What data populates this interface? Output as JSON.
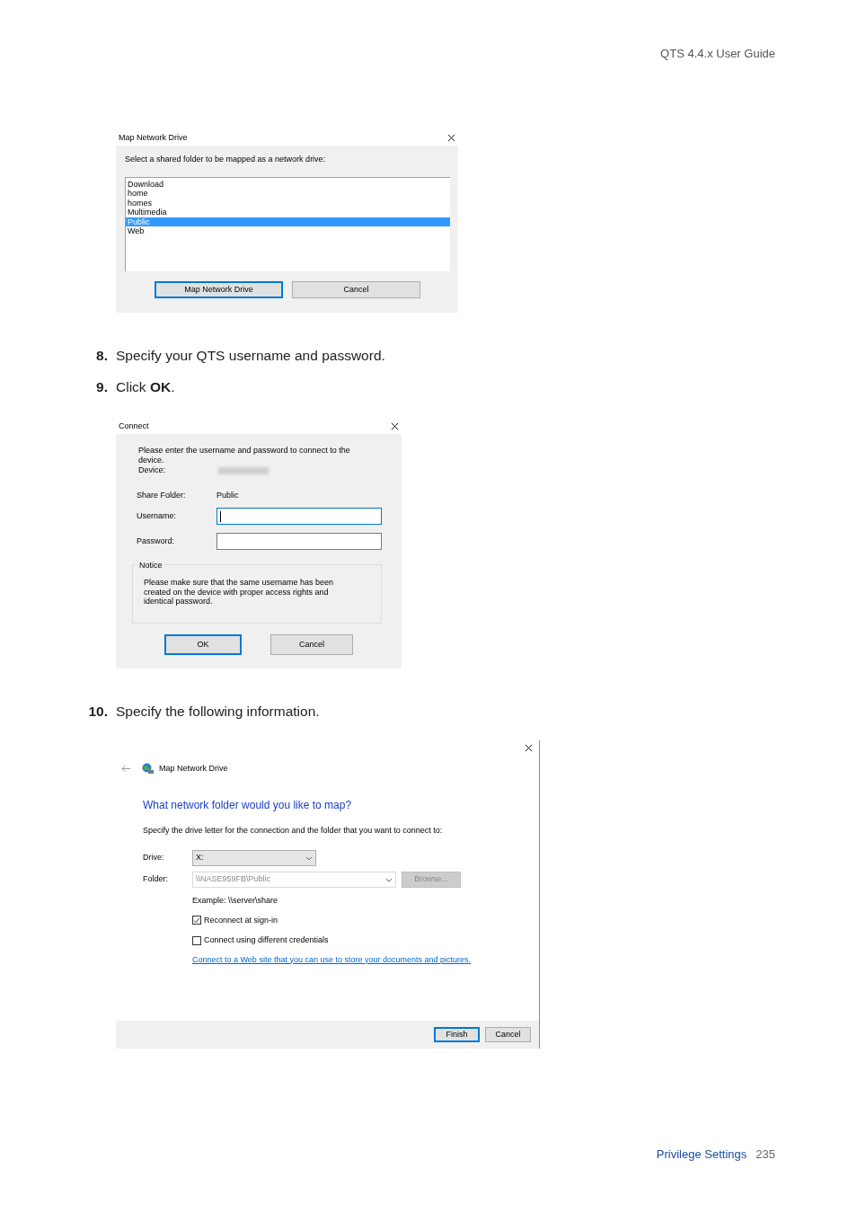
{
  "header": {
    "title": "QTS 4.4.x User Guide"
  },
  "share_dialog": {
    "title": "Map Network Drive",
    "prompt": "Select a shared folder to be mapped as a network drive:",
    "folders": [
      {
        "label": "Download",
        "selected": false
      },
      {
        "label": "home",
        "selected": false
      },
      {
        "label": "homes",
        "selected": false
      },
      {
        "label": "Multimedia",
        "selected": false
      },
      {
        "label": "Public",
        "selected": true
      },
      {
        "label": "Web",
        "selected": false
      }
    ],
    "buttons": [
      {
        "label": "Map Network Drive",
        "default": true
      },
      {
        "label": "Cancel",
        "default": false
      }
    ]
  },
  "steps_a": [
    {
      "number": "8.",
      "text": "Specify your QTS username and password."
    },
    {
      "number": "9.",
      "text": "Click **OK**."
    }
  ],
  "connect_dialog": {
    "title": "Connect",
    "prompt": "Please enter the username and password to connect to the device.",
    "device_label": "Device:",
    "share_label": "Share Folder:",
    "share_value": "Public",
    "fields": [
      {
        "label": "Username:",
        "focused": true
      },
      {
        "label": "Password:",
        "focused": false
      }
    ],
    "notice": {
      "legend": "Notice",
      "text": "Please make sure that the same username has been created on the device with proper access rights and identical password."
    },
    "buttons": [
      {
        "label": "OK",
        "default": true
      },
      {
        "label": "Cancel",
        "default": false
      }
    ]
  },
  "steps_b": [
    {
      "number": "10.",
      "text": "Specify the following information."
    }
  ],
  "wizard_dialog": {
    "title": "Map Network Drive",
    "heading": "What network folder would you like to map?",
    "description": "Specify the drive letter for the connection and the folder that you want to connect to:",
    "drive": {
      "label": "Drive:",
      "value": "X:"
    },
    "folder": {
      "label": "Folder:",
      "value": "\\\\NASE959FB\\Public",
      "disabled": true
    },
    "browse": {
      "label": "Browse...",
      "disabled": true
    },
    "example": "Example: \\\\server\\share",
    "options": [
      {
        "label": "Reconnect at sign-in",
        "checked": true
      },
      {
        "label": "Connect using different credentials",
        "checked": false
      }
    ],
    "link": "Connect to a Web site that you can use to store your documents and pictures.",
    "buttons": [
      {
        "label": "Finish",
        "default": true
      },
      {
        "label": "Cancel",
        "default": false
      }
    ]
  },
  "footer": {
    "section": "Privilege Settings",
    "page": "235"
  }
}
